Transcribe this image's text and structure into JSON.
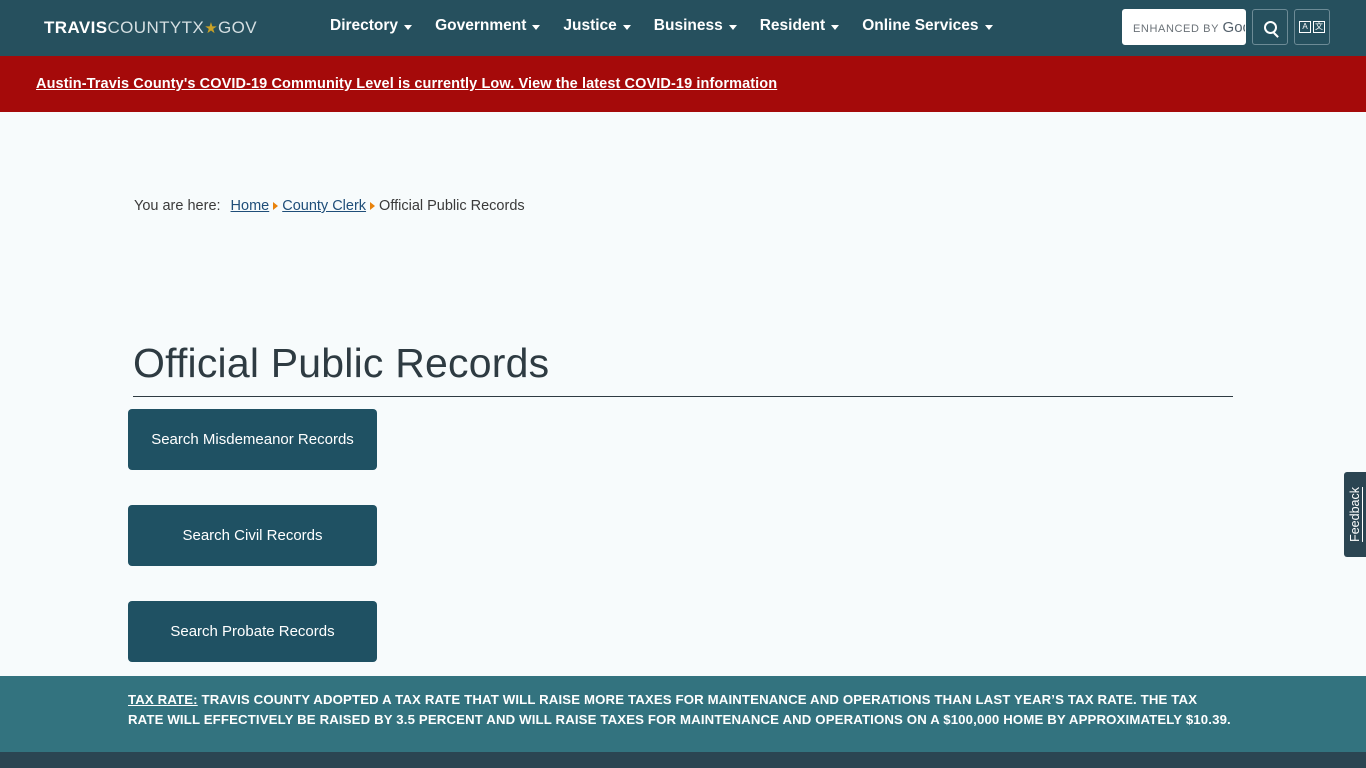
{
  "header": {
    "logo": {
      "bold": "TRAVIS",
      "light": "COUNTYTX",
      "star": "★",
      "tail": "GOV"
    },
    "nav": [
      {
        "label": "Directory"
      },
      {
        "label": "Government"
      },
      {
        "label": "Justice"
      },
      {
        "label": "Business"
      },
      {
        "label": "Resident"
      },
      {
        "label": "Online Services"
      }
    ],
    "search": {
      "placeholder_prefix": "ENHANCED BY ",
      "placeholder_brand": "Goo",
      "value": ""
    },
    "search_button_icon": "search-icon",
    "translate_button": {
      "icon": "translate-icon",
      "latin": "A",
      "cjk": "文"
    }
  },
  "alert": {
    "text": "Austin-Travis County's COVID-19 Community Level is currently Low. View the latest COVID-19 information",
    "color": "#a50a0a"
  },
  "breadcrumb": {
    "lead": "You are here:",
    "items": [
      {
        "label": "Home",
        "link": true
      },
      {
        "label": "County Clerk",
        "link": true
      },
      {
        "label": "Official Public Records",
        "link": false
      }
    ]
  },
  "page": {
    "title": "Official Public Records",
    "buttons": [
      {
        "label": "Search Misdemeanor Records"
      },
      {
        "label": "Search Civil Records"
      },
      {
        "label": "Search Probate Records"
      }
    ]
  },
  "feedback": {
    "label": "Feedback"
  },
  "footer": {
    "link_label": "TAX RATE:",
    "text": " TRAVIS COUNTY ADOPTED A TAX RATE THAT WILL RAISE MORE TAXES FOR MAINTENANCE AND OPERATIONS THAN LAST YEAR’S TAX RATE. THE TAX RATE WILL EFFECTIVELY BE RAISED BY 3.5 PERCENT AND WILL RAISE TAXES FOR MAINTENANCE AND OPERATIONS ON A $100,000 HOME BY APPROXIMATELY $10.39.",
    "color": "#33737f"
  },
  "theme": {
    "header_bg": "#26505e",
    "alert_bg": "#a50a0a",
    "button_bg": "#1f5163",
    "footer_bg": "#33737f",
    "page_bg": "#f7fbfc",
    "accent_star": "#c9a227",
    "breadcrumb_arrow": "#e8820c"
  }
}
